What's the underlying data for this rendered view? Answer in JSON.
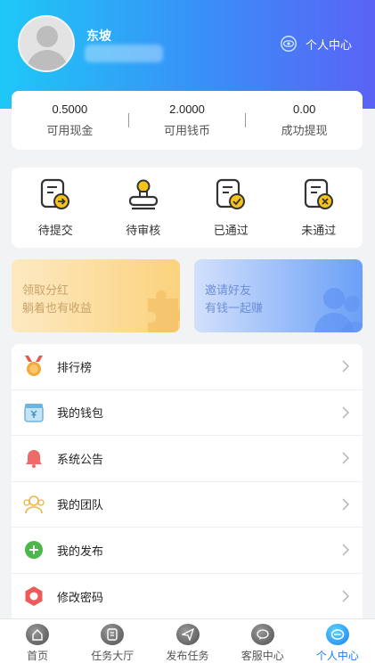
{
  "colors": {
    "header_start": "#1ec8f6",
    "header_end": "#5a63f5",
    "accent": "#1a7cf0"
  },
  "profile": {
    "username": "东坡",
    "avatar_icon": "avatar-placeholder-icon",
    "personal_center_label": "个人中心"
  },
  "stats": [
    {
      "value": "0.5000",
      "label": "可用现金"
    },
    {
      "value": "2.0000",
      "label": "可用钱币"
    },
    {
      "value": "0.00",
      "label": "成功提现"
    }
  ],
  "task_status": [
    {
      "label": "待提交",
      "icon": "submit-doc-icon"
    },
    {
      "label": "待审核",
      "icon": "stamp-icon"
    },
    {
      "label": "已通过",
      "icon": "approved-doc-icon"
    },
    {
      "label": "未通过",
      "icon": "rejected-doc-icon"
    }
  ],
  "promos": {
    "dividend": {
      "line1": "领取分红",
      "line2": "躺着也有收益"
    },
    "invite": {
      "line1": "邀请好友",
      "line2": "有钱一起赚"
    }
  },
  "menu": [
    {
      "label": "排行榜",
      "icon": "medal-icon"
    },
    {
      "label": "我的钱包",
      "icon": "wallet-icon"
    },
    {
      "label": "系统公告",
      "icon": "bell-icon"
    },
    {
      "label": "我的团队",
      "icon": "team-icon"
    },
    {
      "label": "我的发布",
      "icon": "plus-circle-icon"
    },
    {
      "label": "修改密码",
      "icon": "lock-hexagon-icon"
    }
  ],
  "tabbar": [
    {
      "label": "首页",
      "icon": "home-icon",
      "active": false
    },
    {
      "label": "任务大厅",
      "icon": "task-hall-icon",
      "active": false
    },
    {
      "label": "发布任务",
      "icon": "send-icon",
      "active": false
    },
    {
      "label": "客服中心",
      "icon": "chat-icon",
      "active": false
    },
    {
      "label": "个人中心",
      "icon": "user-center-icon",
      "active": true
    }
  ]
}
